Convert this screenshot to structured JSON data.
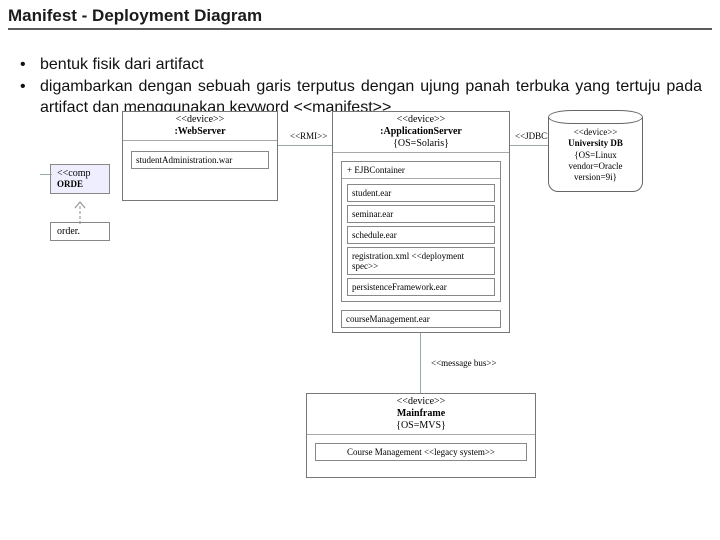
{
  "title": "Manifest - Deployment Diagram",
  "bullets": [
    "bentuk fisik dari artifact",
    "digambarkan dengan sebuah garis terputus dengan ujung panah terbuka yang tertuju pada artifact dan menggunakan keyword <<manifest>>"
  ],
  "left_fragment": {
    "comp": "<<comp",
    "order": "order."
  },
  "web_server": {
    "stereo": "<<device>>",
    "name": ":WebServer",
    "artifact": "studentAdministration.war"
  },
  "app_server": {
    "stereo": "<<device>>",
    "name": ":ApplicationServer",
    "os": "{OS=Solaris}",
    "ejb": {
      "header": "+ EJBContainer",
      "items": [
        "student.ear",
        "seminar.ear",
        "schedule.ear",
        "registration.xml <<deployment spec>>",
        "persistenceFramework.ear"
      ]
    },
    "course_mgmt": "courseManagement.ear"
  },
  "db": {
    "stereo": "<<device>>",
    "name": "University DB",
    "attrs": [
      "{OS=Linux",
      "vendor=Oracle",
      "version=9i}"
    ]
  },
  "mainframe": {
    "stereo": "<<device>>",
    "name": "Mainframe",
    "os": "{OS=MVS}",
    "legacy": "Course Management <<legacy system>>"
  },
  "conn": {
    "rmi": "<<RMI>>",
    "jdbc": "<<JDBC>>",
    "bus": "<<message bus>>"
  }
}
